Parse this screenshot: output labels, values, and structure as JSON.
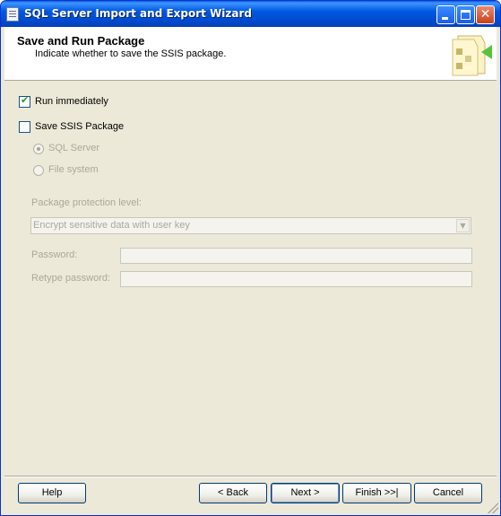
{
  "window": {
    "title": "SQL Server Import and Export Wizard"
  },
  "header": {
    "title": "Save and Run Package",
    "subtitle": "Indicate whether to save the SSIS package."
  },
  "options": {
    "run_immediately": {
      "label": "Run immediately",
      "checked": true
    },
    "save_package": {
      "label": "Save SSIS Package",
      "checked": false
    },
    "sql_server": {
      "label": "SQL Server",
      "selected": true,
      "enabled": false
    },
    "file_system": {
      "label": "File system",
      "selected": false,
      "enabled": false
    }
  },
  "protection": {
    "label": "Package protection level:",
    "value": "Encrypt sensitive data with user key"
  },
  "password": {
    "label": "Password:",
    "value": ""
  },
  "retype_password": {
    "label": "Retype password:",
    "value": ""
  },
  "buttons": {
    "help": "Help",
    "back": "< Back",
    "next": "Next >",
    "finish": "Finish >>|",
    "cancel": "Cancel"
  },
  "icons": {
    "title": "document-window-icon",
    "header": "package-wizard-icon",
    "minimize": "minimize-icon",
    "maximize": "maximize-icon",
    "close": "close-icon"
  }
}
